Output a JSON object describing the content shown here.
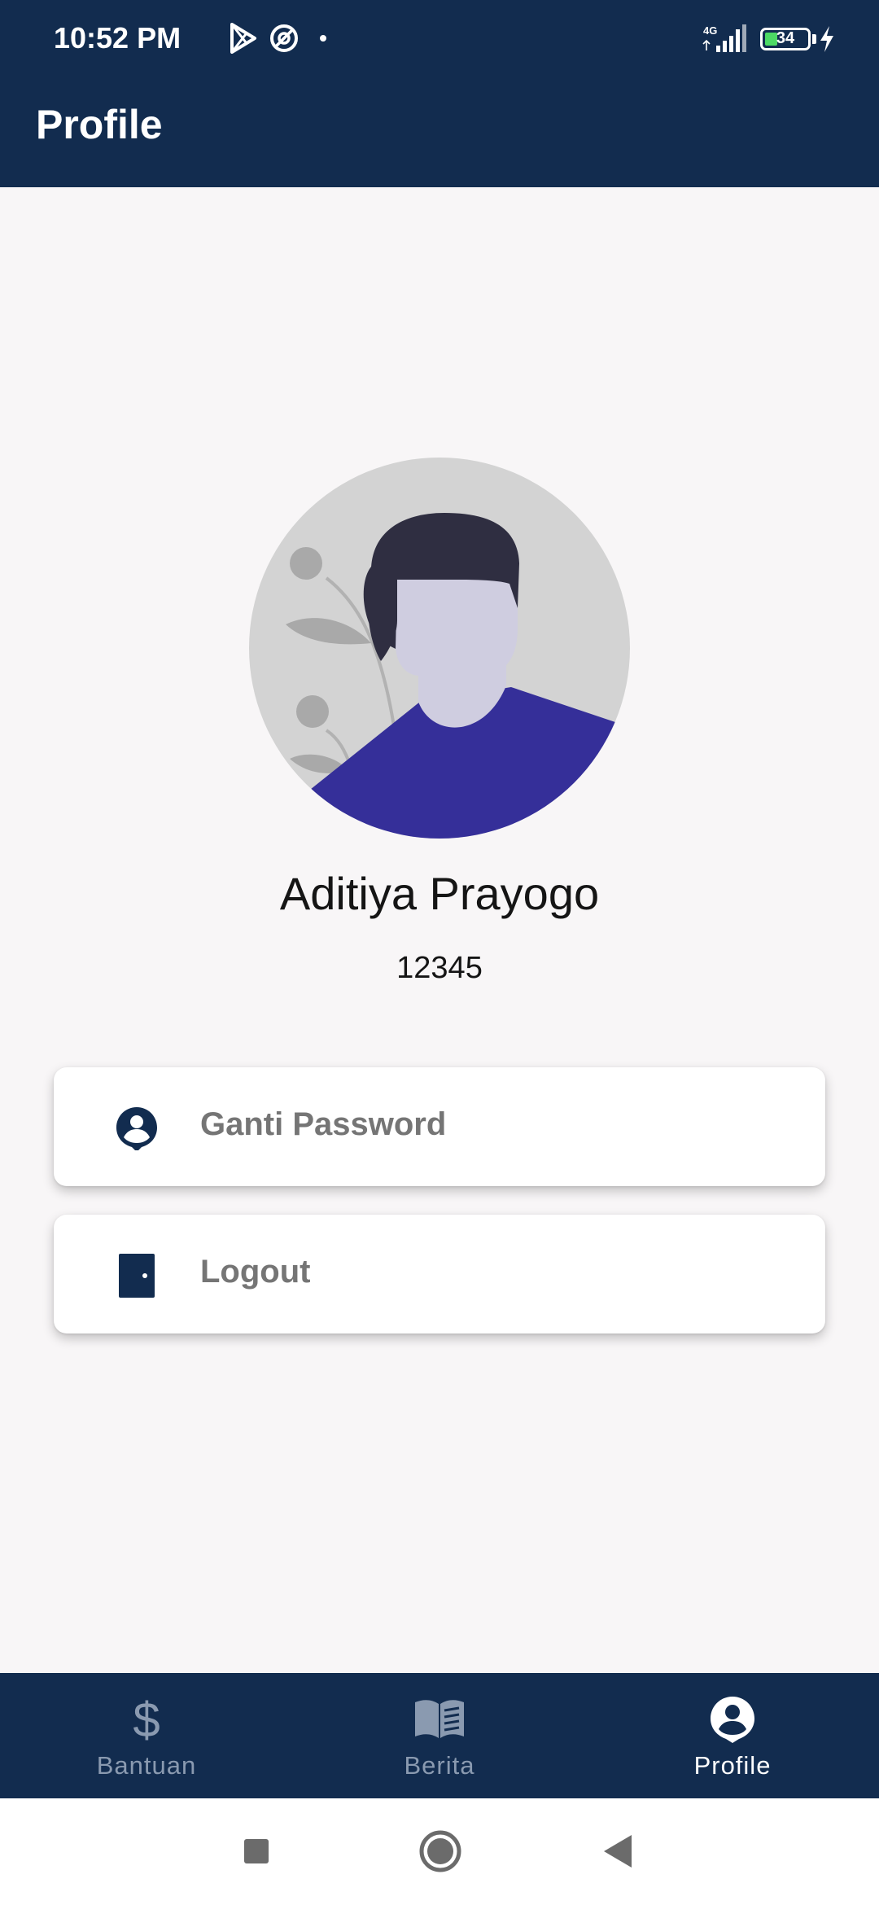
{
  "status_bar": {
    "time": "10:52 PM",
    "network": "4G",
    "battery": "34",
    "icons": [
      "play-store-icon",
      "vpn-icon",
      "notification-dot-icon",
      "signal-icon",
      "battery-icon",
      "charging-icon"
    ]
  },
  "app_bar": {
    "title": "Profile"
  },
  "profile": {
    "name": "Aditiya Prayogo",
    "id": "12345",
    "avatar_icon": "person-illustration"
  },
  "menu": [
    {
      "label": "Ganti Password",
      "icon": "account-circle-icon"
    },
    {
      "label": "Logout",
      "icon": "door-icon"
    }
  ],
  "bottom_nav": [
    {
      "label": "Bantuan",
      "icon": "dollar-icon",
      "active": false
    },
    {
      "label": "Berita",
      "icon": "book-icon",
      "active": false
    },
    {
      "label": "Profile",
      "icon": "account-circle-icon",
      "active": true
    }
  ],
  "colors": {
    "primary": "#122c4f",
    "background": "#f8f6f7",
    "avatar_shirt": "#352f99",
    "label_gray": "#757575"
  },
  "system_nav": [
    "recents-button",
    "home-button",
    "back-button"
  ]
}
